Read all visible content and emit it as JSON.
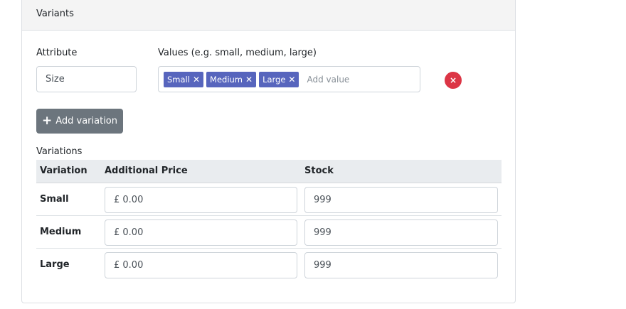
{
  "card": {
    "title": "Variants"
  },
  "attribute": {
    "label": "Attribute",
    "value": "Size"
  },
  "values": {
    "label": "Values (e.g. small, medium, large)",
    "tags": [
      {
        "label": "Small"
      },
      {
        "label": "Medium"
      },
      {
        "label": "Large"
      }
    ],
    "remove_glyph": "✕",
    "placeholder": "Add value"
  },
  "remove_attribute": {
    "glyph": "×",
    "color": "#dc3545"
  },
  "add_variation": {
    "label": "Add variation",
    "icon": "plus-icon"
  },
  "variations": {
    "label": "Variations",
    "columns": [
      "Variation",
      "Additional Price",
      "Stock"
    ],
    "rows": [
      {
        "name": "Small",
        "price": "£ 0.00",
        "stock": "999"
      },
      {
        "name": "Medium",
        "price": "£ 0.00",
        "stock": "999"
      },
      {
        "name": "Large",
        "price": "£ 0.00",
        "stock": "999"
      }
    ]
  },
  "colors": {
    "tag": "#5765bd",
    "button": "#6c757d",
    "header_bg": "#e9ecef"
  }
}
